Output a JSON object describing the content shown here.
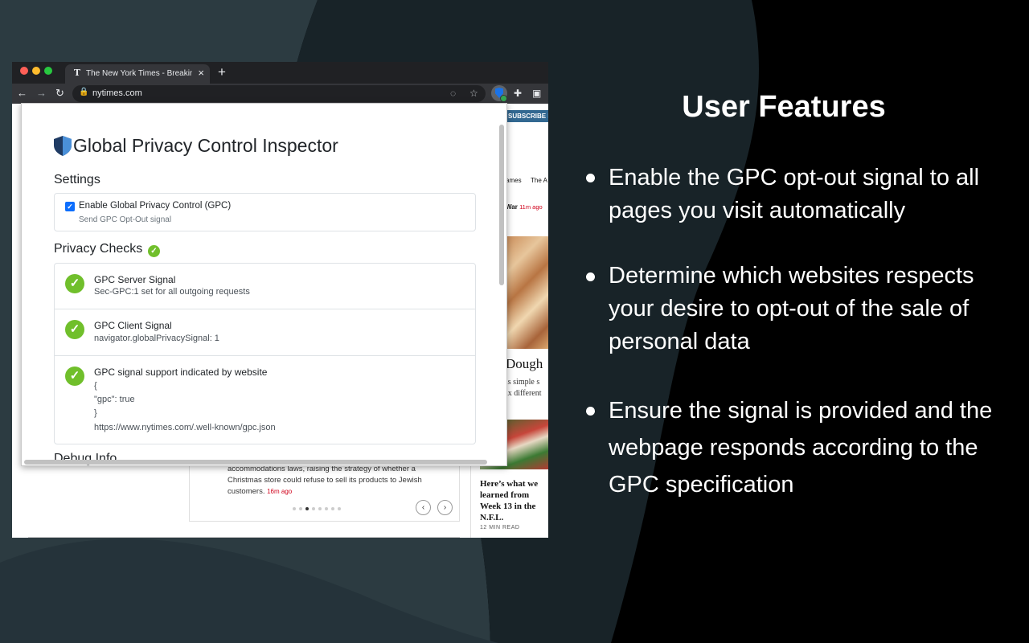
{
  "browser": {
    "tab_favicon": "T",
    "tab_title": "The New York Times - Breaking",
    "tab_close": "×",
    "new_tab": "+",
    "url": "nytimes.com",
    "back": "←",
    "forward": "→",
    "reload": "↻"
  },
  "nyt": {
    "subscribe": "SUBSCRIBE FOR",
    "nav_games": "ames",
    "nav_athletic": "The A",
    "war_label": "War",
    "war_time": "11m ago",
    "dough_headline": "Dough",
    "dough_sub_1": "is simple s",
    "dough_sub_2": "ix different",
    "learned_headline": "Here’s what we learned from Week 13 in the N.F.L.",
    "learned_time": "12 MIN READ",
    "card_text_1": "accommodations laws, raising the strategy of whether a",
    "card_text_2": "Christmas store could refuse to sell its products to Jewish",
    "card_text_3": "customers.",
    "card_time": "16m ago",
    "arrow_prev": "‹",
    "arrow_next": "›"
  },
  "popup": {
    "title": "Global Privacy Control Inspector",
    "settings_heading": "Settings",
    "gpc_checkbox_label": "Enable Global Privacy Control (GPC)",
    "gpc_checkbox_desc": "Send GPC Opt-Out signal",
    "gpc_checkbox_checked": true,
    "privacy_checks_heading": "Privacy Checks",
    "checks": [
      {
        "title": "GPC Server Signal",
        "desc": "Sec-GPC:1 set for all outgoing requests"
      },
      {
        "title": "GPC Client Signal",
        "desc": "navigator.globalPrivacySignal: 1"
      },
      {
        "title": "GPC signal support indicated by website",
        "lines": [
          "{",
          "\"gpc\": true",
          "}",
          "https://www.nytimes.com/.well-known/gpc.json"
        ]
      }
    ],
    "debug_heading": "Debug Info"
  },
  "features": {
    "title": "User Features",
    "items": [
      "Enable the GPC opt-out signal to all pages you visit automatically",
      "Determine which websites respects your desire to opt-out of the sale of personal data",
      "Ensure the signal is provided and the webpage responds according to the GPC specification"
    ]
  },
  "icons": {
    "check": "✓",
    "lock": "🔒",
    "star": "☆",
    "eye_off": "◌",
    "puzzle": "✚",
    "side_panel": "▣"
  },
  "colors": {
    "background_dark": "#000000",
    "background_slate": "#2b3a40",
    "check_green": "#70bf2b",
    "checkbox_blue": "#0d6efd",
    "nyt_blue": "#326891",
    "shield_navy": "#1f3b64"
  }
}
